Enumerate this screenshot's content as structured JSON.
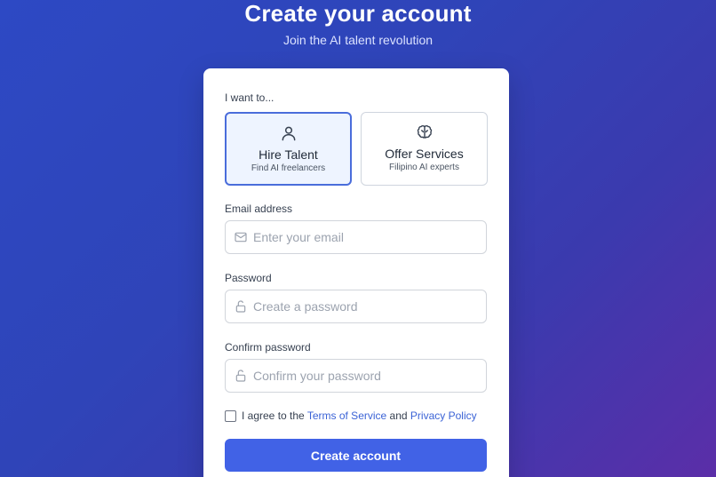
{
  "header": {
    "title": "Create your account",
    "subtitle": "Join the AI talent revolution"
  },
  "form": {
    "role_label": "I want to...",
    "roles": [
      {
        "title": "Hire Talent",
        "subtitle": "Find AI freelancers",
        "icon": "user-icon",
        "selected": true
      },
      {
        "title": "Offer Services",
        "subtitle": "Filipino AI experts",
        "icon": "brain-icon",
        "selected": false
      }
    ],
    "email": {
      "label": "Email address",
      "placeholder": "Enter your email",
      "value": "",
      "icon": "mail-icon"
    },
    "password": {
      "label": "Password",
      "placeholder": "Create a password",
      "value": "",
      "icon": "lock-icon"
    },
    "confirm_password": {
      "label": "Confirm password",
      "placeholder": "Confirm your password",
      "value": "",
      "icon": "lock-icon"
    },
    "agree": {
      "checked": false,
      "prefix": "I agree to the",
      "terms_link": "Terms of Service",
      "conjunction": "and",
      "privacy_link": "Privacy Policy"
    },
    "submit_label": "Create account"
  },
  "colors": {
    "primary": "#4162e6",
    "link": "#3b63d6",
    "selected_border": "#4a6ddb",
    "selected_bg": "#eef4ff"
  }
}
